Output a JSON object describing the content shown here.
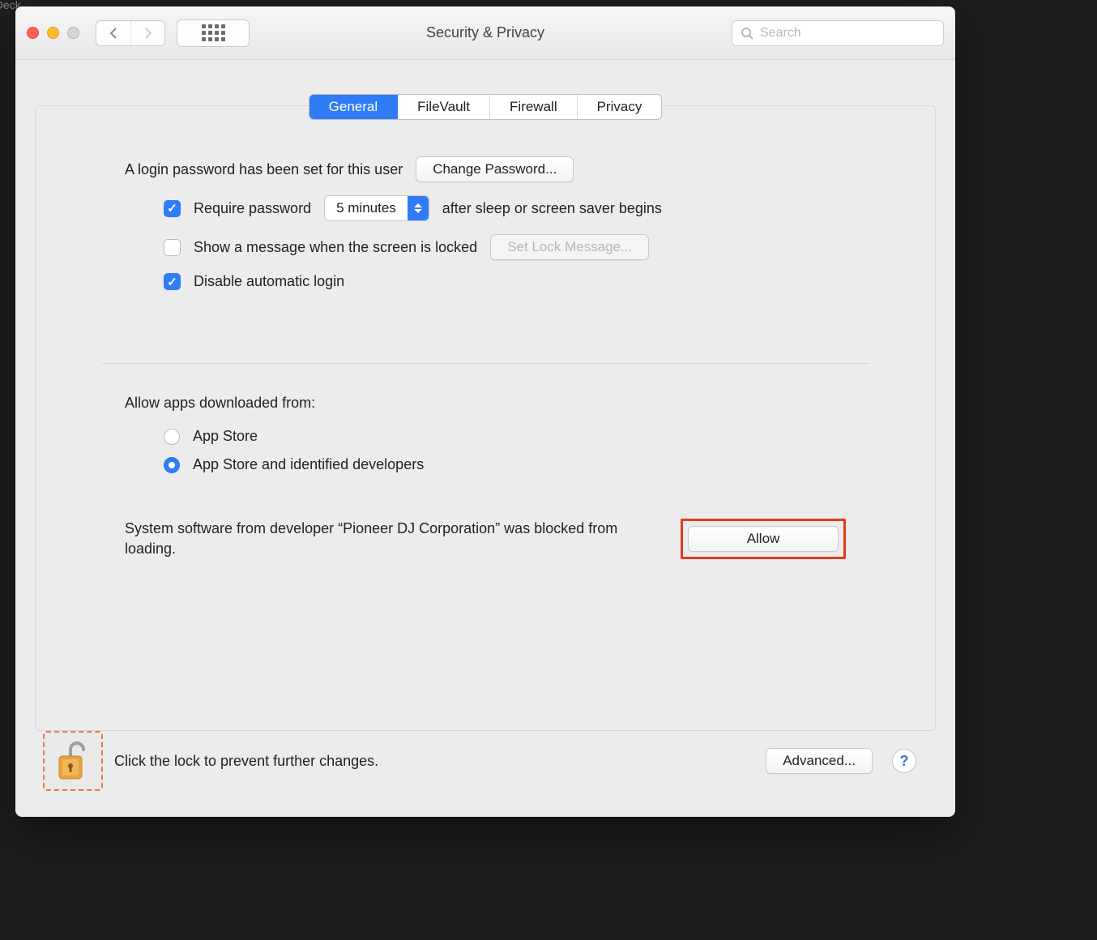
{
  "toolbar": {
    "title": "Security & Privacy",
    "search_placeholder": "Search"
  },
  "tabs": {
    "general": "General",
    "filevault": "FileVault",
    "firewall": "Firewall",
    "privacy": "Privacy",
    "active": "general"
  },
  "general": {
    "login_password_set": "A login password has been set for this user",
    "change_password_btn": "Change Password...",
    "require_password_label": "Require password",
    "require_password_delay": "5 minutes",
    "require_password_suffix": "after sleep or screen saver begins",
    "show_message_label": "Show a message when the screen is locked",
    "set_lock_message_btn": "Set Lock Message...",
    "disable_auto_login_label": "Disable automatic login",
    "allow_apps_heading": "Allow apps downloaded from:",
    "radio_app_store": "App Store",
    "radio_app_store_dev": "App Store and identified developers",
    "blocked_text": "System software from developer “Pioneer DJ Corporation” was blocked from loading.",
    "allow_btn": "Allow"
  },
  "footer": {
    "lock_text": "Click the lock to prevent further changes.",
    "advanced_btn": "Advanced...",
    "help": "?"
  },
  "bg": {
    "fragment": "Playing Deck"
  }
}
